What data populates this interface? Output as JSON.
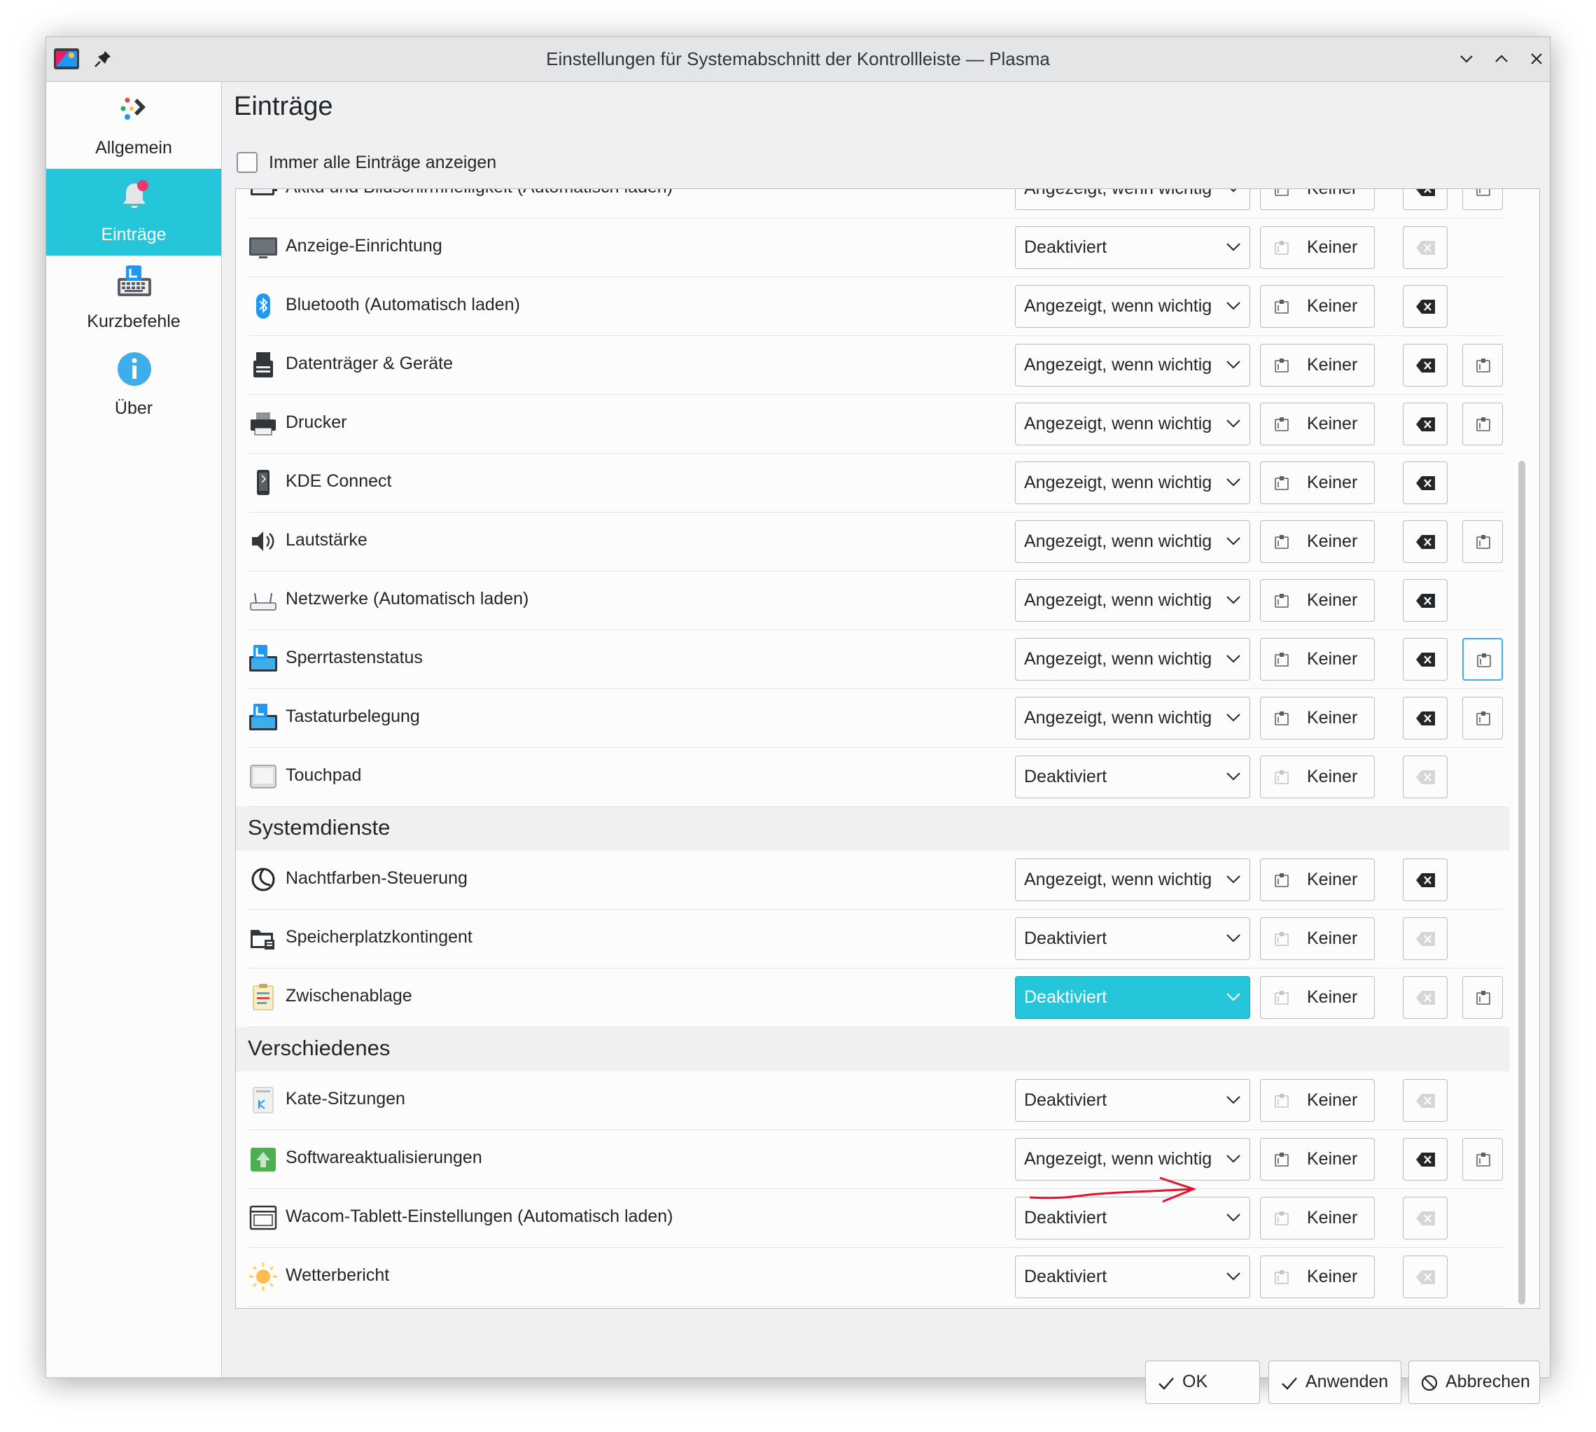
{
  "window": {
    "title": "Einstellungen für Systemabschnitt der Kontrollleiste — Plasma"
  },
  "sidebar": {
    "items": [
      {
        "label": "Allgemein",
        "icon": "general-icon",
        "active": false
      },
      {
        "label": "Einträge",
        "icon": "notification-bell-icon",
        "active": true
      },
      {
        "label": "Kurzbefehle",
        "icon": "keyboard-shortcut-icon",
        "active": false
      },
      {
        "label": "Über",
        "icon": "info-icon",
        "active": false
      }
    ]
  },
  "main": {
    "title": "Einträge",
    "show_all_checkbox": {
      "label": "Immer alle Einträge anzeigen",
      "checked": false
    }
  },
  "entries": [
    {
      "name": "Akku und Bildschirmhelligkeit (Automatisch laden)",
      "visibility": "Angezeigt, wenn wichtig",
      "shortcut": "Keiner",
      "icon": "battery-icon",
      "clear_enabled": true,
      "has_config": true
    },
    {
      "name": "Anzeige-Einrichtung",
      "visibility": "Deaktiviert",
      "shortcut": "Keiner",
      "icon": "monitor-icon",
      "clear_enabled": false,
      "has_config": false
    },
    {
      "name": "Bluetooth (Automatisch laden)",
      "visibility": "Angezeigt, wenn wichtig",
      "shortcut": "Keiner",
      "icon": "bluetooth-icon",
      "clear_enabled": true,
      "has_config": false
    },
    {
      "name": "Datenträger & Geräte",
      "visibility": "Angezeigt, wenn wichtig",
      "shortcut": "Keiner",
      "icon": "usb-drive-icon",
      "clear_enabled": true,
      "has_config": true
    },
    {
      "name": "Drucker",
      "visibility": "Angezeigt, wenn wichtig",
      "shortcut": "Keiner",
      "icon": "printer-icon",
      "clear_enabled": true,
      "has_config": true
    },
    {
      "name": "KDE Connect",
      "visibility": "Angezeigt, wenn wichtig",
      "shortcut": "Keiner",
      "icon": "phone-icon",
      "clear_enabled": true,
      "has_config": false
    },
    {
      "name": "Lautstärke",
      "visibility": "Angezeigt, wenn wichtig",
      "shortcut": "Keiner",
      "icon": "speaker-icon",
      "clear_enabled": true,
      "has_config": true
    },
    {
      "name": "Netzwerke (Automatisch laden)",
      "visibility": "Angezeigt, wenn wichtig",
      "shortcut": "Keiner",
      "icon": "network-router-icon",
      "clear_enabled": true,
      "has_config": false
    },
    {
      "name": "Sperrtastenstatus",
      "visibility": "Angezeigt, wenn wichtig",
      "shortcut": "Keiner",
      "icon": "keyboard-icon",
      "clear_enabled": true,
      "has_config": true,
      "config_focused": true
    },
    {
      "name": "Tastaturbelegung",
      "visibility": "Angezeigt, wenn wichtig",
      "shortcut": "Keiner",
      "icon": "keyboard-icon",
      "clear_enabled": true,
      "has_config": true
    },
    {
      "name": "Touchpad",
      "visibility": "Deaktiviert",
      "shortcut": "Keiner",
      "icon": "touchpad-icon",
      "clear_enabled": false,
      "has_config": false
    }
  ],
  "sections": [
    {
      "title": "Systemdienste",
      "entries": [
        {
          "name": "Nachtfarben-Steuerung",
          "visibility": "Angezeigt, wenn wichtig",
          "shortcut": "Keiner",
          "icon": "night-color-icon",
          "clear_enabled": true,
          "has_config": false
        },
        {
          "name": "Speicherplatzkontingent",
          "visibility": "Deaktiviert",
          "shortcut": "Keiner",
          "icon": "folder-quota-icon",
          "clear_enabled": false,
          "has_config": false
        },
        {
          "name": "Zwischenablage",
          "visibility": "Deaktiviert",
          "shortcut": "Keiner",
          "icon": "clipboard-icon",
          "clear_enabled": false,
          "has_config": true,
          "selected": true
        }
      ]
    },
    {
      "title": "Verschiedenes",
      "entries": [
        {
          "name": "Kate-Sitzungen",
          "visibility": "Deaktiviert",
          "shortcut": "Keiner",
          "icon": "kate-icon",
          "clear_enabled": false,
          "has_config": false
        },
        {
          "name": "Softwareaktualisierungen",
          "visibility": "Angezeigt, wenn wichtig",
          "shortcut": "Keiner",
          "icon": "software-update-icon",
          "clear_enabled": true,
          "has_config": true
        },
        {
          "name": "Wacom-Tablett-Einstellungen (Automatisch laden)",
          "visibility": "Deaktiviert",
          "shortcut": "Keiner",
          "icon": "tablet-icon",
          "clear_enabled": false,
          "has_config": false
        },
        {
          "name": "Wetterbericht",
          "visibility": "Deaktiviert",
          "shortcut": "Keiner",
          "icon": "weather-sun-icon",
          "clear_enabled": false,
          "has_config": false
        }
      ]
    }
  ],
  "buttons": {
    "ok": "OK",
    "apply": "Anwenden",
    "cancel": "Abbrechen"
  },
  "colors": {
    "accent": "#26c6da",
    "window_bg": "#eff0f1",
    "view_bg": "#fcfcfc",
    "annotation_arrow": "#e8102a"
  }
}
